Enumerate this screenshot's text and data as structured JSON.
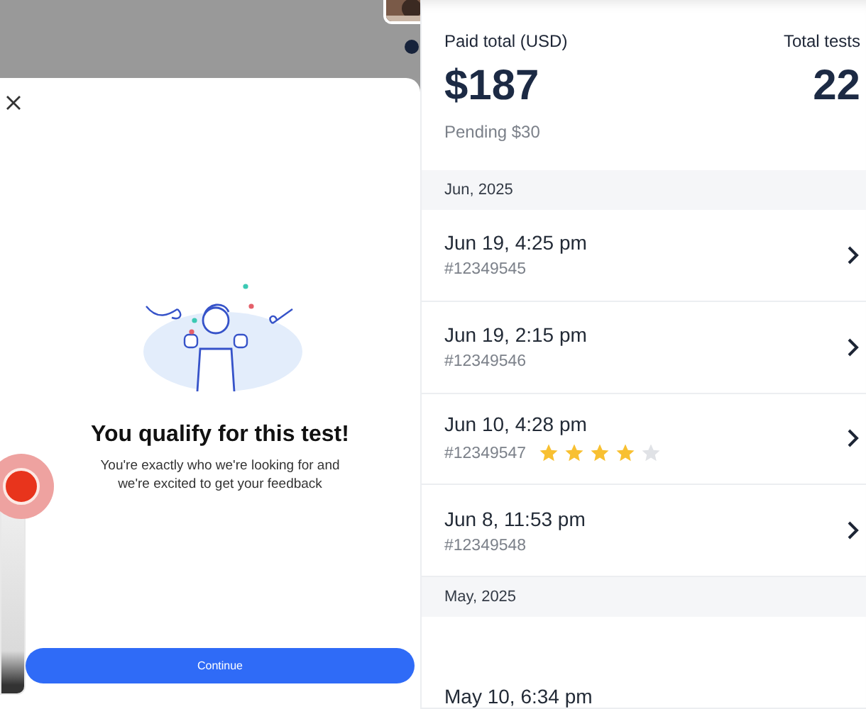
{
  "modal": {
    "title": "You qualify for this test!",
    "message": "You're exactly who we're looking for and we're excited to get your feedback",
    "button": "Continue"
  },
  "summary": {
    "paid_label": "Paid total (USD)",
    "paid_value": "$187",
    "pending": "Pending $30",
    "tests_label": "Total tests",
    "tests_value": "22"
  },
  "sections": [
    {
      "heading": "Jun, 2025",
      "rows": [
        {
          "date": "Jun 19, 4:25 pm",
          "id": "#12349545"
        },
        {
          "date": "Jun 19, 2:15 pm",
          "id": "#12349546"
        },
        {
          "date": "Jun 10, 4:28 pm",
          "id": "#12349547",
          "stars": 4
        },
        {
          "date": "Jun 8, 11:53 pm",
          "id": "#12349548"
        }
      ]
    },
    {
      "heading": "May, 2025",
      "rows": [
        {
          "date": "May 10, 6:34 pm"
        }
      ]
    }
  ]
}
